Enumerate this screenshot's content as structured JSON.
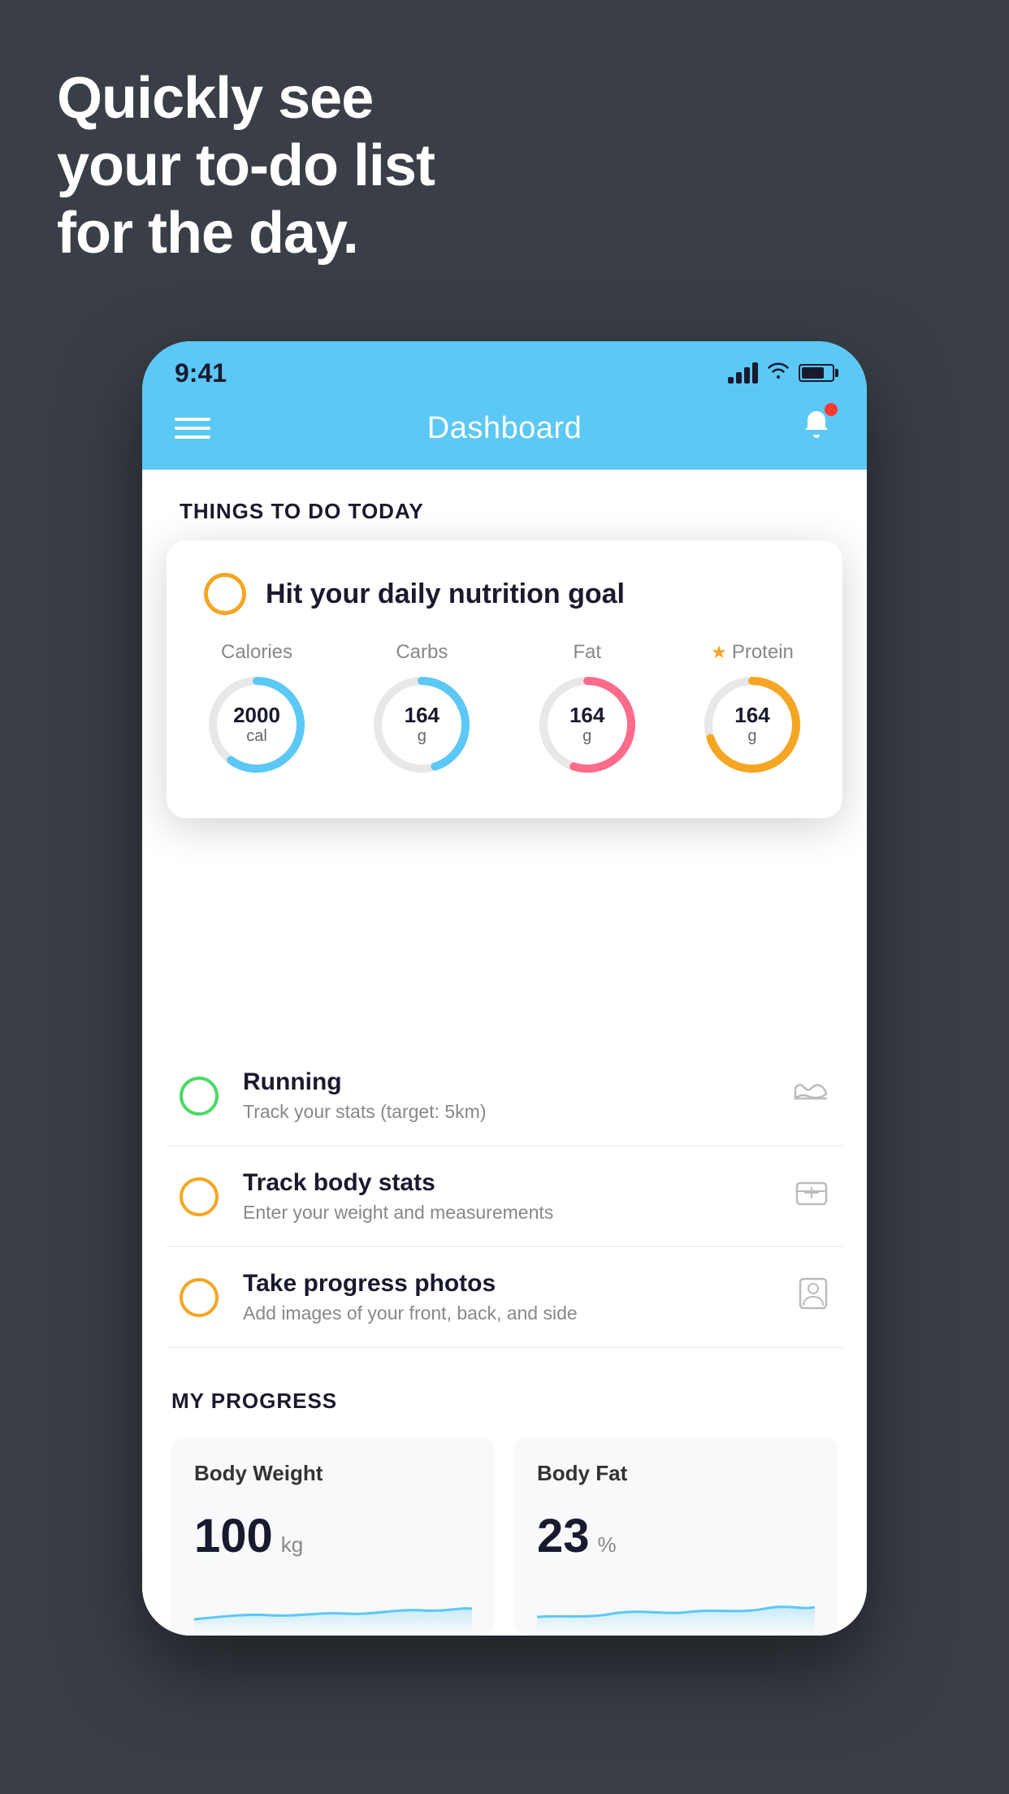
{
  "headline": {
    "line1": "Quickly see",
    "line2": "your to-do list",
    "line3": "for the day."
  },
  "status_bar": {
    "time": "9:41"
  },
  "nav": {
    "title": "Dashboard"
  },
  "things_to_do": {
    "section_label": "THINGS TO DO TODAY"
  },
  "nutrition_card": {
    "title": "Hit your daily nutrition goal",
    "items": [
      {
        "label": "Calories",
        "value": "2000",
        "unit": "cal",
        "color": "#5bc8f5",
        "percent": 60,
        "star": false
      },
      {
        "label": "Carbs",
        "value": "164",
        "unit": "g",
        "color": "#5bc8f5",
        "percent": 45,
        "star": false
      },
      {
        "label": "Fat",
        "value": "164",
        "unit": "g",
        "color": "#ff6b8a",
        "percent": 55,
        "star": false
      },
      {
        "label": "Protein",
        "value": "164",
        "unit": "g",
        "color": "#f5a623",
        "percent": 70,
        "star": true
      }
    ]
  },
  "todo_items": [
    {
      "title": "Running",
      "subtitle": "Track your stats (target: 5km)",
      "circle_color": "green",
      "icon": "shoe"
    },
    {
      "title": "Track body stats",
      "subtitle": "Enter your weight and measurements",
      "circle_color": "yellow",
      "icon": "scale"
    },
    {
      "title": "Take progress photos",
      "subtitle": "Add images of your front, back, and side",
      "circle_color": "yellow",
      "icon": "person"
    }
  ],
  "progress": {
    "section_label": "MY PROGRESS",
    "cards": [
      {
        "title": "Body Weight",
        "value": "100",
        "unit": "kg"
      },
      {
        "title": "Body Fat",
        "value": "23",
        "unit": "%"
      }
    ]
  }
}
